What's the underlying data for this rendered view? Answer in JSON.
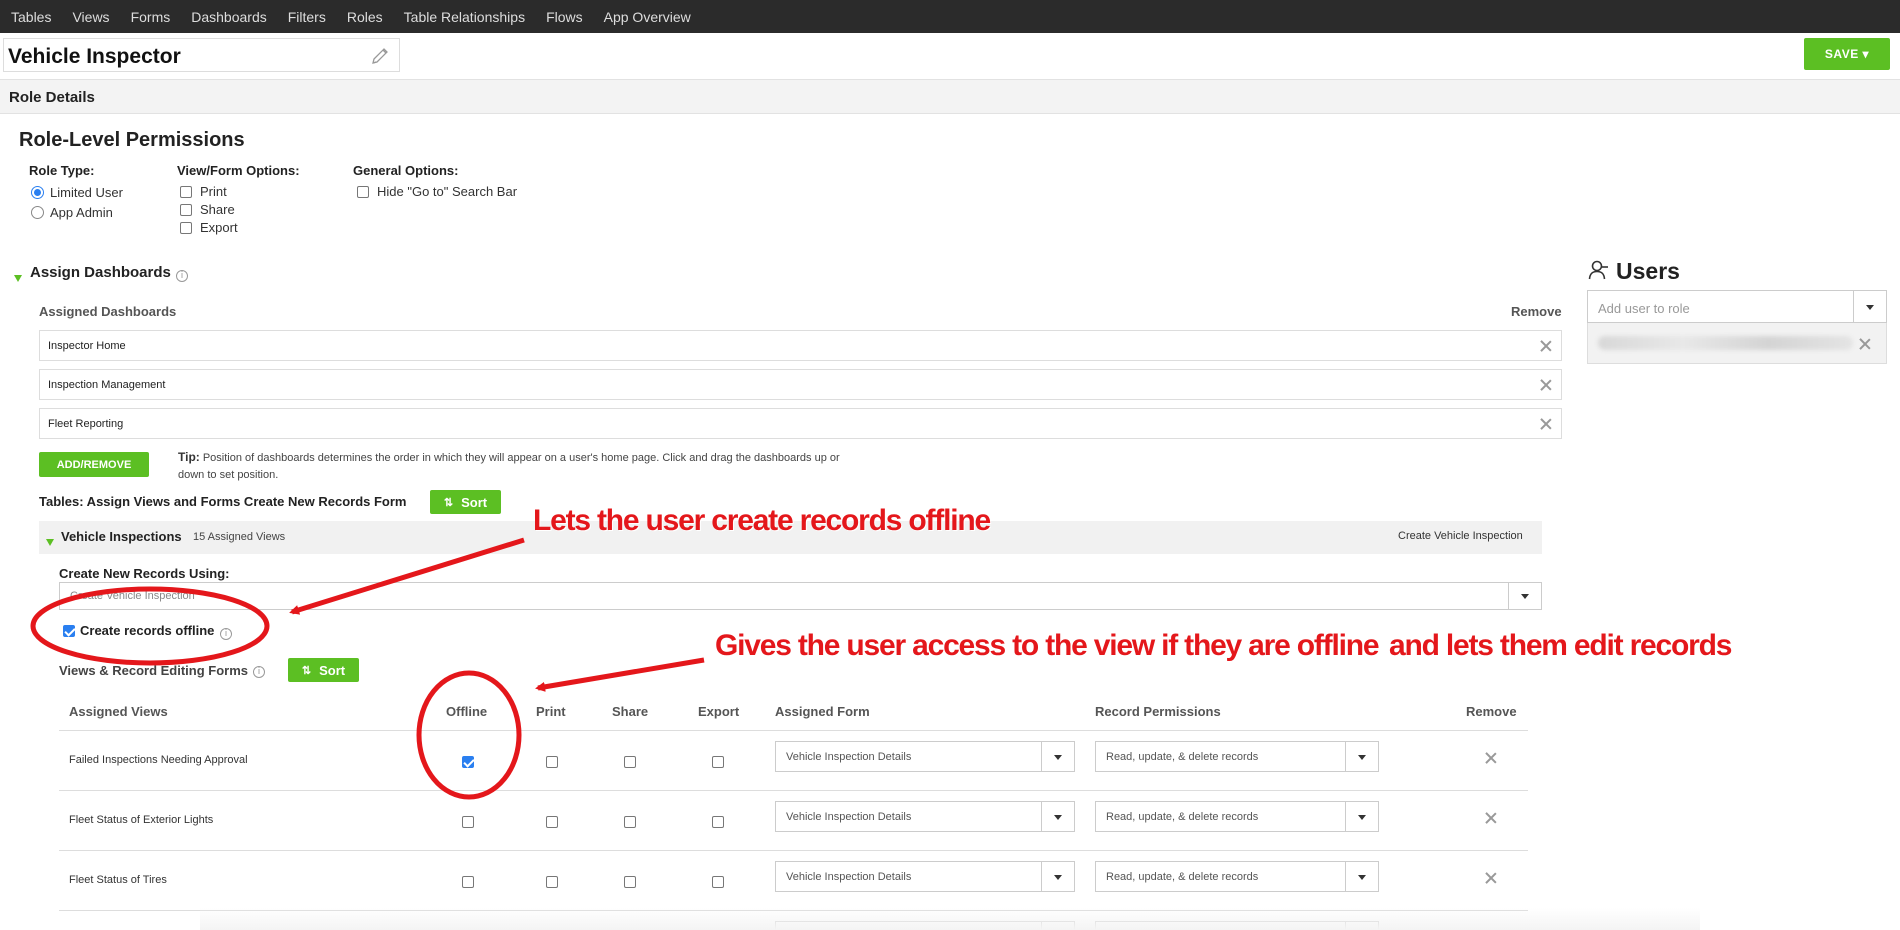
{
  "nav": [
    "Tables",
    "Views",
    "Forms",
    "Dashboards",
    "Filters",
    "Roles",
    "Table Relationships",
    "Flows",
    "App Overview"
  ],
  "app": {
    "title": "Vehicle Inspector",
    "save_label": "SAVE"
  },
  "section": {
    "title": "Role Details"
  },
  "permissions": {
    "heading": "Role-Level Permissions",
    "role_type": {
      "label": "Role Type:",
      "options": [
        "Limited User",
        "App Admin"
      ],
      "selected": "Limited User"
    },
    "view_form": {
      "label": "View/Form Options:",
      "options": [
        "Print",
        "Share",
        "Export"
      ]
    },
    "general": {
      "label": "General Options:",
      "options": [
        "Hide \"Go to\" Search Bar"
      ]
    }
  },
  "dashboards": {
    "heading": "Assign Dashboards",
    "column_label": "Assigned Dashboards",
    "remove_label": "Remove",
    "items": [
      "Inspector Home",
      "Inspection Management",
      "Fleet Reporting"
    ],
    "add_remove_label": "ADD/REMOVE",
    "tip_label": "Tip:",
    "tip_text_1": "Position of dashboards determines the order in which they will appear on a user's home page. Click and drag the dashboards up or",
    "tip_text_2": "down to set position."
  },
  "tables": {
    "heading": "Tables: Assign Views and Forms Create New Records Form",
    "sort_label": "Sort",
    "table_name": "Vehicle Inspections",
    "assigned_count": "15 Assigned Views",
    "create_link": "Create Vehicle Inspection",
    "create_using_label": "Create New Records Using:",
    "create_using_value": "Create Vehicle Inspection",
    "offline_label": "Create records offline",
    "offline_checked": true,
    "views_heading": "Views & Record Editing Forms"
  },
  "views_table": {
    "headers": [
      "Assigned Views",
      "Offline",
      "Print",
      "Share",
      "Export",
      "Assigned Form",
      "Record Permissions",
      "Remove"
    ],
    "rows": [
      {
        "name": "Failed Inspections Needing Approval",
        "offline": true,
        "print": false,
        "share": false,
        "export": false,
        "form": "Vehicle Inspection Details",
        "perm": "Read, update, & delete records"
      },
      {
        "name": "Fleet Status of Exterior Lights",
        "offline": false,
        "print": false,
        "share": false,
        "export": false,
        "form": "Vehicle Inspection Details",
        "perm": "Read, update, & delete records"
      },
      {
        "name": "Fleet Status of Tires",
        "offline": false,
        "print": false,
        "share": false,
        "export": false,
        "form": "Vehicle Inspection Details",
        "perm": "Read, update, & delete records"
      }
    ]
  },
  "users": {
    "heading": "Users",
    "placeholder": "Add user to role"
  },
  "annotations": {
    "offline_records": "Lets the user create records offline",
    "offline_view_a": "Gives the user access to the view if they are offline",
    "offline_view_b": "and lets them edit records"
  },
  "colors": {
    "accent_green": "#5cbf23",
    "annotation_red": "#e4171b",
    "nav_bg": "#2b2b2b",
    "check_blue": "#2a7ff0"
  }
}
